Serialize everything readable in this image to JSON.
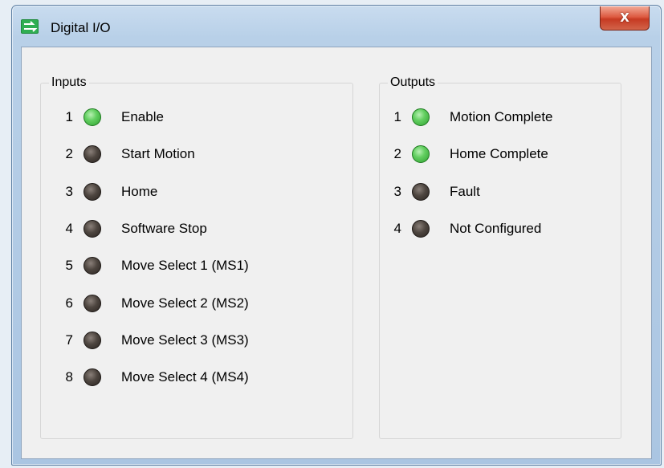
{
  "window": {
    "title": "Digital I/O",
    "close_label": "X"
  },
  "colors": {
    "led_on": "#5ccd5a",
    "led_off": "#3b342f",
    "titlebar": "#b8d0e8",
    "client_bg": "#f0f0f0"
  },
  "icons": {
    "app": "digital-io-icon",
    "close": "close-icon"
  },
  "inputs": {
    "label": "Inputs",
    "items": [
      {
        "num": "1",
        "label": "Enable",
        "state": "on"
      },
      {
        "num": "2",
        "label": "Start Motion",
        "state": "off"
      },
      {
        "num": "3",
        "label": "Home",
        "state": "off"
      },
      {
        "num": "4",
        "label": "Software Stop",
        "state": "off"
      },
      {
        "num": "5",
        "label": "Move Select 1 (MS1)",
        "state": "off"
      },
      {
        "num": "6",
        "label": "Move Select 2 (MS2)",
        "state": "off"
      },
      {
        "num": "7",
        "label": "Move Select 3 (MS3)",
        "state": "off"
      },
      {
        "num": "8",
        "label": "Move Select 4 (MS4)",
        "state": "off"
      }
    ]
  },
  "outputs": {
    "label": "Outputs",
    "items": [
      {
        "num": "1",
        "label": "Motion Complete",
        "state": "on"
      },
      {
        "num": "2",
        "label": "Home Complete",
        "state": "on"
      },
      {
        "num": "3",
        "label": "Fault",
        "state": "off"
      },
      {
        "num": "4",
        "label": "Not Configured",
        "state": "off"
      }
    ]
  }
}
